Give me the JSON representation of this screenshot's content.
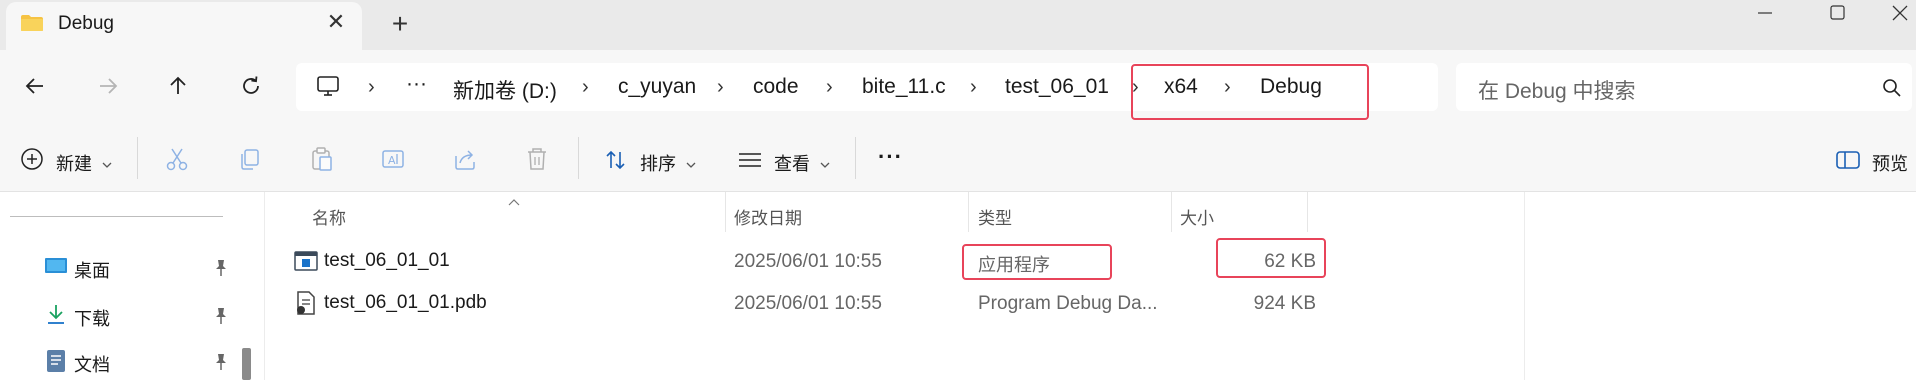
{
  "window": {
    "tab_title": "Debug",
    "close_glyph": "✕",
    "add_tab_glyph": "+"
  },
  "nav": {
    "back_icon": "arrow-left-icon",
    "forward_icon": "arrow-right-icon",
    "up_icon": "arrow-up-icon",
    "refresh_icon": "refresh-icon"
  },
  "breadcrumb": {
    "more": "···",
    "items": [
      "新加卷 (D:)",
      "c_yuyan",
      "code",
      "bite_11.c",
      "test_06_01",
      "x64",
      "Debug"
    ],
    "separator": "›"
  },
  "search": {
    "placeholder": "在 Debug 中搜索"
  },
  "toolbar": {
    "new_label": "新建",
    "sort_label": "排序",
    "view_label": "查看",
    "more_label": "···",
    "preview_label": "预览"
  },
  "sidebar": {
    "items": [
      {
        "label": "桌面",
        "icon": "desktop-icon"
      },
      {
        "label": "下载",
        "icon": "download-icon"
      },
      {
        "label": "文档",
        "icon": "document-icon"
      }
    ]
  },
  "table": {
    "columns": [
      "名称",
      "修改日期",
      "类型",
      "大小"
    ],
    "rows": [
      {
        "name": "test_06_01_01",
        "date": "2025/06/01 10:55",
        "type": "应用程序",
        "size": "62 KB",
        "icon": "exe-icon"
      },
      {
        "name": "test_06_01_01.pdb",
        "date": "2025/06/01 10:55",
        "type": "Program Debug Da...",
        "size": "924 KB",
        "icon": "pdb-file-icon"
      }
    ]
  },
  "colors": {
    "highlight": "#e8445a",
    "folder": "#f6c343",
    "accent": "#1a73c9"
  }
}
